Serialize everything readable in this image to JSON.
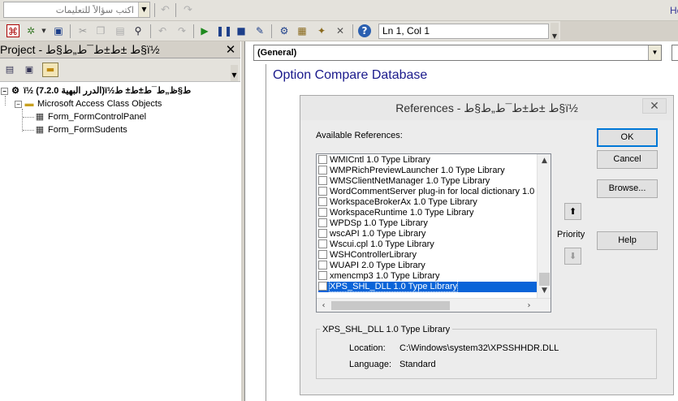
{
  "toolbar": {
    "ask_question_placeholder": "اكتب سؤالاً للتعليمات",
    "help_menu_partial": "He",
    "position_readout": "Ln 1, Col 1"
  },
  "project": {
    "title": "Project - ط ±ط±ط¯ط„ط§ط§ï½",
    "root_label": "ï½ (الدرر البهية 7.2.0)ï½ط§ظ„ط¯ط±ط± ط",
    "folder_label": "Microsoft Access Class Objects",
    "items": [
      {
        "label": "Form_FormControlPanel"
      },
      {
        "label": "Form_FormSudents"
      }
    ]
  },
  "code": {
    "object_selector_value": "(General)",
    "first_line": "Option Compare Database"
  },
  "dialog": {
    "title": "References - ط ±ط±ط¯ط„ط§ط§ï½",
    "close_glyph": "✕",
    "available_label": "Available References:",
    "references": [
      {
        "label": "WMICntl 1.0 Type Library",
        "checked": false,
        "selected": false
      },
      {
        "label": "WMPRichPreviewLauncher 1.0 Type Library",
        "checked": false,
        "selected": false
      },
      {
        "label": "WMSClientNetManager 1.0 Type Library",
        "checked": false,
        "selected": false
      },
      {
        "label": "WordCommentServer plug-in for local dictionary 1.0 T",
        "checked": false,
        "selected": false
      },
      {
        "label": "WorkspaceBrokerAx 1.0 Type Library",
        "checked": false,
        "selected": false
      },
      {
        "label": "WorkspaceRuntime 1.0 Type Library",
        "checked": false,
        "selected": false
      },
      {
        "label": "WPDSp 1.0 Type Library",
        "checked": false,
        "selected": false
      },
      {
        "label": "wscAPI 1.0 Type Library",
        "checked": false,
        "selected": false
      },
      {
        "label": "Wscui.cpl 1.0 Type Library",
        "checked": false,
        "selected": false
      },
      {
        "label": "WSHControllerLibrary",
        "checked": false,
        "selected": false
      },
      {
        "label": "WUAPI 2.0 Type Library",
        "checked": false,
        "selected": false
      },
      {
        "label": "xmencmp3 1.0 Type Library",
        "checked": false,
        "selected": false
      },
      {
        "label": "XPS_SHL_DLL 1.0 Type Library",
        "checked": false,
        "selected": true
      }
    ],
    "buttons": {
      "ok": "OK",
      "cancel": "Cancel",
      "browse": "Browse...",
      "help": "Help"
    },
    "priority_label": "Priority",
    "selected_ref": {
      "name": "XPS_SHL_DLL 1.0 Type Library",
      "location_label": "Location:",
      "location_value": "C:\\Windows\\system32\\XPSSHHDR.DLL",
      "language_label": "Language:",
      "language_value": "Standard"
    }
  },
  "icons": [
    "dropdown-arrow-icon",
    "undo-icon",
    "redo-icon",
    "access-view-icon",
    "insert-module-icon",
    "save-icon",
    "cut-icon",
    "copy-icon",
    "paste-icon",
    "find-icon",
    "run-icon",
    "break-icon",
    "reset-icon",
    "design-mode-icon",
    "project-explorer-icon",
    "properties-icon",
    "object-browser-icon",
    "toolbox-icon",
    "help-icon",
    "view-code-icon",
    "view-object-icon",
    "toggle-folders-icon"
  ],
  "colors": {
    "code_keyword": "#1a1a8c",
    "selection": "#0a64d8",
    "default_button_border": "#0078d7"
  }
}
